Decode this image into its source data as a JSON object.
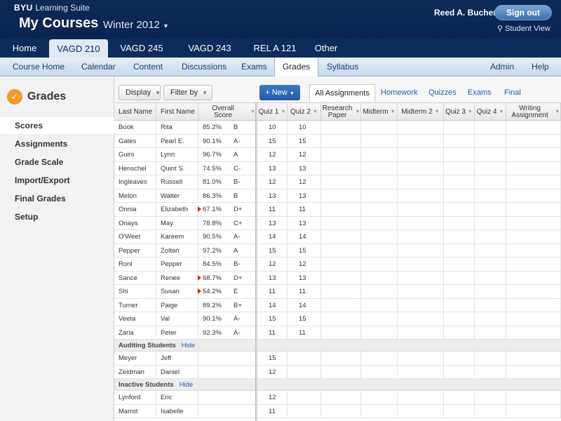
{
  "header": {
    "brand": "BYU",
    "suite": "Learning Suite",
    "title": "My Courses",
    "term_separator": "·",
    "term": "Winter 2012",
    "user_name": "Reed A. Bucher",
    "signout_label": "Sign out",
    "student_view_label": "Student View"
  },
  "course_tabs": [
    "Home",
    "VAGD 210",
    "VAGD 245",
    "VAGD 243",
    "REL A 121",
    "Other"
  ],
  "active_course": "VAGD 210",
  "subnav": {
    "left": [
      "Course Home",
      "Calendar",
      "Content",
      "Discussions",
      "Exams",
      "Grades",
      "Syllabus"
    ],
    "right": [
      "Admin",
      "Help"
    ],
    "active": "Grades"
  },
  "sidebar": {
    "title": "Grades",
    "items": [
      "Scores",
      "Assignments",
      "Grade Scale",
      "Import/Export",
      "Final Grades",
      "Setup"
    ],
    "active": "Scores"
  },
  "toolbar": {
    "display_label": "Display",
    "filter_label": "Filter by",
    "new_label": "+ New",
    "filter_tabs": [
      "All Assignments",
      "Homework",
      "Quizzes",
      "Exams",
      "Final Exam"
    ],
    "active_filter": "All Assignments"
  },
  "columns": {
    "student": [
      "Last Name",
      "First Name",
      "Overall Score"
    ],
    "assignments": [
      "Quiz 1",
      "Quiz 2",
      "Research Paper",
      "Midterm",
      "Midterm 2",
      "Quiz 3",
      "Quiz 4",
      "Writing Assignment"
    ]
  },
  "students": [
    {
      "last": "Book",
      "first": "Rita",
      "score": "85.2%",
      "grade": "B",
      "flag": false,
      "quiz1": "10",
      "quiz2": "10"
    },
    {
      "last": "Gates",
      "first": "Pearl E.",
      "score": "90.1%",
      "grade": "A-",
      "flag": false,
      "quiz1": "15",
      "quiz2": "15"
    },
    {
      "last": "Guini",
      "first": "Lynn",
      "score": "96.7%",
      "grade": "A",
      "flag": false,
      "quiz1": "12",
      "quiz2": "12"
    },
    {
      "last": "Henschel",
      "first": "Quint S.",
      "score": "74.5%",
      "grade": "C-",
      "flag": false,
      "quiz1": "13",
      "quiz2": "13"
    },
    {
      "last": "Ingleaves",
      "first": "Russell",
      "score": "81.0%",
      "grade": "B-",
      "flag": false,
      "quiz1": "12",
      "quiz2": "12"
    },
    {
      "last": "Melon",
      "first": "Walter",
      "score": "86.3%",
      "grade": "B",
      "flag": false,
      "quiz1": "13",
      "quiz2": "13"
    },
    {
      "last": "Onnia",
      "first": "Elizabeth",
      "score": "67.1%",
      "grade": "D+",
      "flag": true,
      "quiz1": "11",
      "quiz2": "11"
    },
    {
      "last": "Onays",
      "first": "May",
      "score": "78.8%",
      "grade": "C+",
      "flag": false,
      "quiz1": "13",
      "quiz2": "13"
    },
    {
      "last": "O'Weet",
      "first": "Kareem",
      "score": "90.5%",
      "grade": "A-",
      "flag": false,
      "quiz1": "14",
      "quiz2": "14"
    },
    {
      "last": "Pepper",
      "first": "Zoltan",
      "score": "97.2%",
      "grade": "A",
      "flag": false,
      "quiz1": "15",
      "quiz2": "15"
    },
    {
      "last": "Roni",
      "first": "Pepper",
      "score": "84.5%",
      "grade": "B-",
      "flag": false,
      "quiz1": "12",
      "quiz2": "12"
    },
    {
      "last": "Sance",
      "first": "Renee",
      "score": "68.7%",
      "grade": "D+",
      "flag": true,
      "quiz1": "13",
      "quiz2": "13"
    },
    {
      "last": "Shi",
      "first": "Susan",
      "score": "54.2%",
      "grade": "E",
      "flag": true,
      "quiz1": "11",
      "quiz2": "11"
    },
    {
      "last": "Turner",
      "first": "Paige",
      "score": "89.2%",
      "grade": "B+",
      "flag": false,
      "quiz1": "14",
      "quiz2": "14"
    },
    {
      "last": "Veeta",
      "first": "Val",
      "score": "90.1%",
      "grade": "A-",
      "flag": false,
      "quiz1": "15",
      "quiz2": "15"
    },
    {
      "last": "Zaria",
      "first": "Peter",
      "score": "92.3%",
      "grade": "A-",
      "flag": false,
      "quiz1": "11",
      "quiz2": "11"
    }
  ],
  "auditing": {
    "label": "Auditing Students",
    "hide_label": "Hide",
    "students": [
      {
        "last": "Meyer",
        "first": "Jeff",
        "quiz1": "15"
      },
      {
        "last": "Zeldman",
        "first": "Daniel",
        "quiz1": "12"
      }
    ]
  },
  "inactive": {
    "label": "Inactive Students",
    "hide_label": "Hide",
    "students": [
      {
        "last": "Lynford",
        "first": "Eric",
        "quiz1": "12"
      },
      {
        "last": "Marrot",
        "first": "Isabelle",
        "quiz1": "11"
      }
    ]
  },
  "colors": {
    "header_bg": "#0b2c5d",
    "accent": "#2060b0",
    "flag": "#c8281e",
    "check": "#f19a2a"
  }
}
